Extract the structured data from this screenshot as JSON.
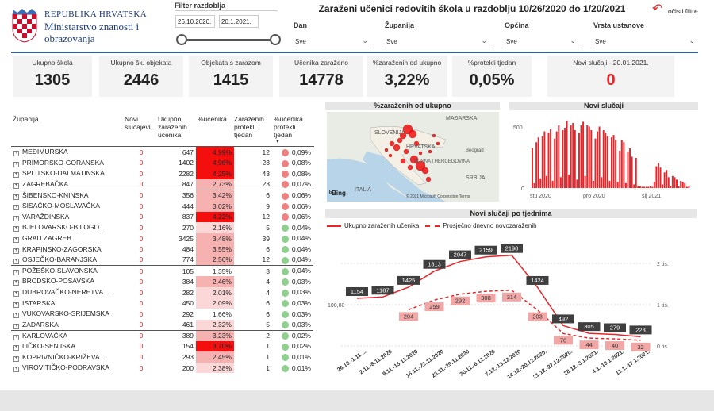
{
  "logo": {
    "line1": "REPUBLIKA HRVATSKA",
    "line2": "Ministarstvo znanosti i",
    "line3": "obrazovanja"
  },
  "date_filter": {
    "label": "Filter razdoblja",
    "from": "26.10.2020.",
    "to": "20.1.2021."
  },
  "page_title": "Zaraženi učenici redovitih škola u razdoblju 10/26/2020 do 1/20/2021",
  "clear_filters": "očisti filtre",
  "filters": [
    {
      "label": "Dan",
      "value": "Sve"
    },
    {
      "label": "Županija",
      "value": "Sve"
    },
    {
      "label": "Općina",
      "value": "Sve"
    },
    {
      "label": "Vrsta ustanove",
      "value": "Sve"
    }
  ],
  "kpis": [
    {
      "label": "Ukupno škola",
      "value": "1305"
    },
    {
      "label": "Ukupno šk. objekata",
      "value": "2446"
    },
    {
      "label": "Objekata s zarazom",
      "value": "1415"
    },
    {
      "label": "Učenika zaraženo",
      "value": "14778"
    },
    {
      "label": "%zaraženih od ukupno",
      "value": "3,22%"
    },
    {
      "label": "%protekli tjedan",
      "value": "0,05%"
    },
    {
      "label": "Novi slučaji - 20.01.2021.",
      "value": "0"
    }
  ],
  "table": {
    "headers": [
      "Županija",
      "Novi slučajevi",
      "Ukupno zaraženih učenika",
      "%učenika",
      "Zaraženih protekli tjedan",
      "%učenika protekli tjedan"
    ],
    "rows": [
      {
        "name": "MEĐIMURSKA",
        "novi": "0",
        "ukupno": "647",
        "pct": "4,99%",
        "tj": "12",
        "pct_tj": "0,09%"
      },
      {
        "name": "PRIMORSKO-GORANSKA",
        "novi": "0",
        "ukupno": "1402",
        "pct": "4,96%",
        "tj": "23",
        "pct_tj": "0,08%"
      },
      {
        "name": "SPLITSKO-DALMATINSKA",
        "novi": "0",
        "ukupno": "2282",
        "pct": "4,25%",
        "tj": "43",
        "pct_tj": "0,08%"
      },
      {
        "name": "ZAGREBAČKA",
        "novi": "0",
        "ukupno": "847",
        "pct": "2,73%",
        "tj": "23",
        "pct_tj": "0,07%"
      },
      {
        "name": "ŠIBENSKO-KNINSKA",
        "novi": "0",
        "ukupno": "356",
        "pct": "3,42%",
        "tj": "6",
        "pct_tj": "0,06%"
      },
      {
        "name": "SISAČKO-MOSLAVAČKA",
        "novi": "0",
        "ukupno": "444",
        "pct": "3,02%",
        "tj": "9",
        "pct_tj": "0,06%"
      },
      {
        "name": "VARAŽDINSKA",
        "novi": "0",
        "ukupno": "837",
        "pct": "4,22%",
        "tj": "12",
        "pct_tj": "0,06%"
      },
      {
        "name": "BJELOVARSKO-BILOGO...",
        "novi": "0",
        "ukupno": "270",
        "pct": "2,16%",
        "tj": "5",
        "pct_tj": "0,04%"
      },
      {
        "name": "GRAD ZAGREB",
        "novi": "0",
        "ukupno": "3425",
        "pct": "3,48%",
        "tj": "39",
        "pct_tj": "0,04%"
      },
      {
        "name": "KRAPINSKO-ZAGORSKA",
        "novi": "0",
        "ukupno": "484",
        "pct": "3,55%",
        "tj": "6",
        "pct_tj": "0,04%"
      },
      {
        "name": "OSJEČKO-BARANJSKA",
        "novi": "0",
        "ukupno": "774",
        "pct": "2,56%",
        "tj": "12",
        "pct_tj": "0,04%"
      },
      {
        "name": "POŽEŠKO-SLAVONSKA",
        "novi": "0",
        "ukupno": "105",
        "pct": "1,35%",
        "tj": "3",
        "pct_tj": "0,04%"
      },
      {
        "name": "BRODSKO-POSAVSKA",
        "novi": "0",
        "ukupno": "384",
        "pct": "2,46%",
        "tj": "4",
        "pct_tj": "0,03%"
      },
      {
        "name": "DUBROVAČKO-NERETVA...",
        "novi": "0",
        "ukupno": "282",
        "pct": "2,01%",
        "tj": "4",
        "pct_tj": "0,03%"
      },
      {
        "name": "ISTARSKA",
        "novi": "0",
        "ukupno": "450",
        "pct": "2,09%",
        "tj": "6",
        "pct_tj": "0,03%"
      },
      {
        "name": "VUKOVARSKO-SRIJEMSKA",
        "novi": "0",
        "ukupno": "292",
        "pct": "1,66%",
        "tj": "6",
        "pct_tj": "0,03%"
      },
      {
        "name": "ZADARSKA",
        "novi": "0",
        "ukupno": "461",
        "pct": "2,32%",
        "tj": "5",
        "pct_tj": "0,03%"
      },
      {
        "name": "KARLOVAČKA",
        "novi": "0",
        "ukupno": "389",
        "pct": "3,23%",
        "tj": "2",
        "pct_tj": "0,02%"
      },
      {
        "name": "LIČKO-SENJSKA",
        "novi": "0",
        "ukupno": "154",
        "pct": "3,70%",
        "tj": "1",
        "pct_tj": "0,02%"
      },
      {
        "name": "KOPRIVNIČKO-KRIŽEVA...",
        "novi": "0",
        "ukupno": "293",
        "pct": "2,45%",
        "tj": "1",
        "pct_tj": "0,01%"
      },
      {
        "name": "VIROVITIČKO-PODRAVSKA",
        "novi": "0",
        "ukupno": "200",
        "pct": "2,38%",
        "tj": "1",
        "pct_tj": "0,01%"
      }
    ]
  },
  "map": {
    "title": "%zaraženih od ukupno",
    "labels": [
      "MAĐARSKA",
      "SLOVENIJA",
      "HRVATSKA",
      "BOSNA I HERCEGOVINA",
      "SRBIJA",
      "ITALIA",
      "Beograd"
    ],
    "bing": "Bing",
    "copyright": "© 2021 Microsoft Corporation Terms"
  },
  "colors": {
    "accent": "#e8262a",
    "header_blue": "#1a3a7a",
    "cell_red_strong": "#f40e0e",
    "cell_red_light": "#f6b1b1",
    "green_dot": "#8fd08f",
    "red_dot": "#f08080"
  },
  "chart_data": [
    {
      "type": "bar",
      "title": "Novi slučaji",
      "yticks": [
        "500",
        "0"
      ],
      "xtick_labels": [
        "stu 2020",
        "pro 2020",
        "sij 2021"
      ],
      "values": [
        330,
        40,
        380,
        420,
        80,
        430,
        470,
        100,
        460,
        490,
        60,
        410,
        470,
        520,
        90,
        480,
        500,
        560,
        110,
        520,
        540,
        480,
        70,
        460,
        520,
        550,
        100,
        520,
        510,
        480,
        60,
        410,
        470,
        510,
        90,
        480,
        460,
        430,
        60,
        420,
        440,
        400,
        50,
        310,
        400,
        380,
        40,
        300,
        330,
        260,
        30,
        250,
        20,
        15,
        10,
        10,
        10,
        10,
        15,
        10,
        50,
        180,
        210,
        170,
        30,
        130,
        150,
        90,
        20,
        100,
        90,
        70,
        15,
        60,
        50,
        40,
        10,
        20
      ]
    },
    {
      "type": "line",
      "title": "Novi slučaji po tjednima",
      "categories": [
        "26.10.-1.11....",
        "2.11.-8.11.2020",
        "9.11.-15.11.2020",
        "16.11.-22.11.2020",
        "23.11.-29.11.2020",
        "30.11.-6.12.2020",
        "7.12.-13.12.2020",
        "14.12.-20.12.2020.",
        "21.12.-27.12.2020.",
        "28.12.-3.1.2021.",
        "4.1.-10.1.2021.",
        "11.1.-17.1.2021."
      ],
      "series": [
        {
          "name": "Ukupno zaraženih učenika",
          "values": [
            1154,
            1187,
            1425,
            1813,
            2047,
            2159,
            2198,
            1424,
            492,
            305,
            279,
            223
          ]
        },
        {
          "name": "Prosječno dnevno novozaraženih",
          "values": [
            null,
            null,
            204,
            259,
            292,
            308,
            314,
            203,
            70,
            44,
            40,
            32
          ]
        }
      ],
      "yticks": [
        "2 tis.",
        "1 tis.",
        "0 tis."
      ],
      "y_extra_label": "100,00"
    }
  ]
}
